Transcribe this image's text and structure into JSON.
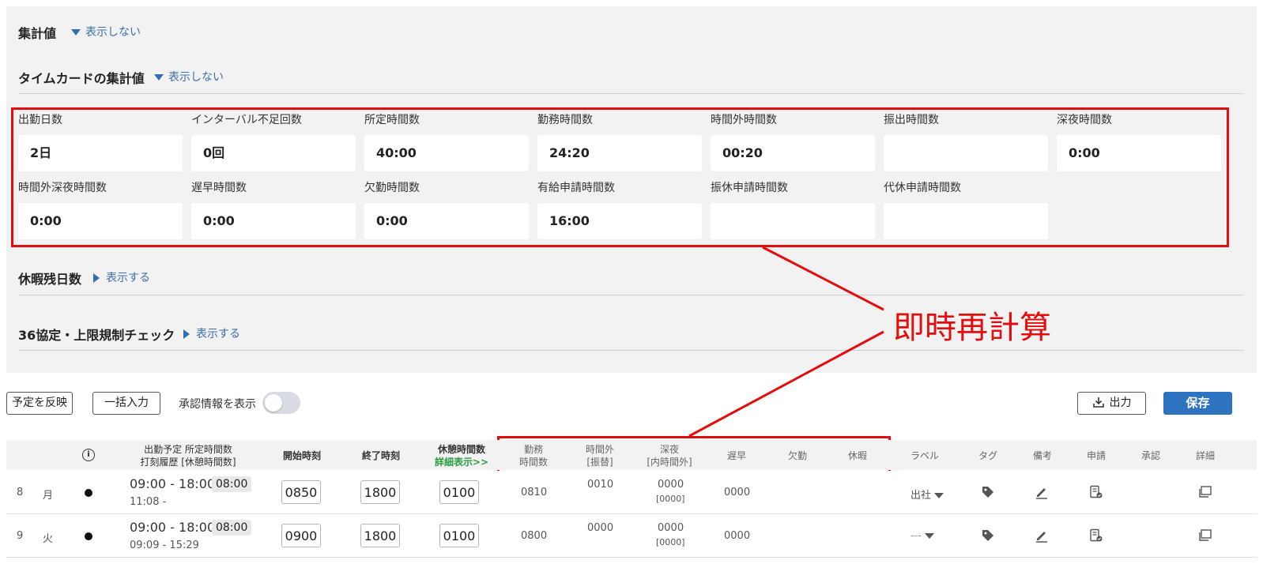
{
  "summary": {
    "title": "集計値",
    "toggle": "表示しない"
  },
  "timecard": {
    "title": "タイムカードの集計値",
    "toggle": "表示しない",
    "items": [
      {
        "label": "出勤日数",
        "value": "2日"
      },
      {
        "label": "インターバル不足回数",
        "value": "0回"
      },
      {
        "label": "所定時間数",
        "value": "40:00"
      },
      {
        "label": "勤務時間数",
        "value": "24:20"
      },
      {
        "label": "時間外時間数",
        "value": "00:20"
      },
      {
        "label": "振出時間数",
        "value": ""
      },
      {
        "label": "深夜時間数",
        "value": "0:00"
      },
      {
        "label": "時間外深夜時間数",
        "value": "0:00"
      },
      {
        "label": "遅早時間数",
        "value": "0:00"
      },
      {
        "label": "欠勤時間数",
        "value": "0:00"
      },
      {
        "label": "有給申請時間数",
        "value": "16:00"
      },
      {
        "label": "振休申請時間数",
        "value": ""
      },
      {
        "label": "代休申請時間数",
        "value": ""
      }
    ]
  },
  "leave": {
    "title": "休暇残日数",
    "toggle": "表示する"
  },
  "agreement36": {
    "title": "36協定・上限規制チェック",
    "toggle": "表示する"
  },
  "annotation": {
    "text": "即時再計算",
    "color": "#e40d0d"
  },
  "toolbar": {
    "reflect_label": "予定を反映",
    "bulk_label": "一括入力",
    "approval_toggle_label": "承認情報を表示",
    "output_label": "出力",
    "save_label": "保存"
  },
  "table": {
    "headers": {
      "schedule_top": "出勤予定  所定時間数",
      "schedule_bottom": "打刻履歴 [休憩時間数]",
      "start": "開始時刻",
      "end": "終了時刻",
      "break_top": "休憩時間数",
      "break_link": "詳細表示>>",
      "work_top": "勤務",
      "work_bottom": "時間数",
      "overtime_top": "時間外",
      "overtime_bottom": "[振替]",
      "night_top": "深夜",
      "night_bottom": "[内時間外]",
      "late": "遅早",
      "absence": "欠勤",
      "vacation": "休暇",
      "label": "ラベル",
      "tag": "タグ",
      "note": "備考",
      "request": "申請",
      "approval": "承認",
      "detail": "詳細"
    },
    "rows": [
      {
        "day": "8",
        "weekday": "月",
        "schedule": "09:00 - 18:00",
        "scheduled_hours": "08:00",
        "stamp": "11:08  -",
        "start": "0850",
        "end": "1800",
        "break": "0100",
        "work": "0810",
        "overtime": "0010",
        "night": "0000",
        "night_sub": "[0000]",
        "late": "0000",
        "label": "出社"
      },
      {
        "day": "9",
        "weekday": "火",
        "schedule": "09:00 - 18:00",
        "scheduled_hours": "08:00",
        "stamp": "09:09  - 15:29",
        "start": "0900",
        "end": "1800",
        "break": "0100",
        "work": "0800",
        "overtime": "0000",
        "night": "0000",
        "night_sub": "[0000]",
        "late": "0000",
        "label": "---"
      }
    ]
  }
}
